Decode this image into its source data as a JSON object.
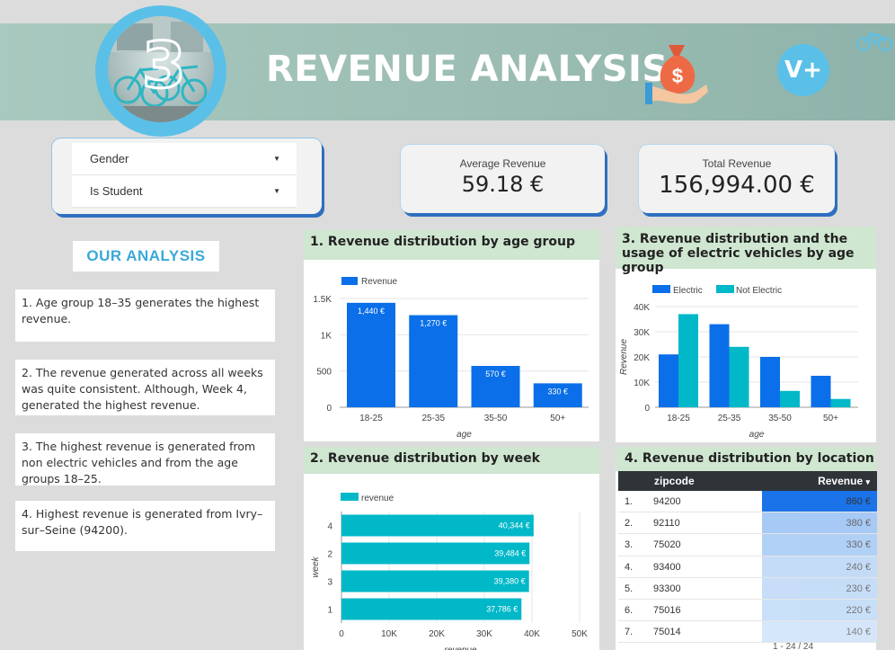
{
  "header": {
    "title": "REVENUE ANALYSIS",
    "logo_text": "3",
    "badge_text": "V+",
    "icons": [
      "bikes-logo",
      "moneybag-icon",
      "bike-icon"
    ]
  },
  "filters": {
    "gender_label": "Gender",
    "student_label": "Is Student"
  },
  "kpis": {
    "avg_label": "Average Revenue",
    "avg_value": "59.18 €",
    "total_label": "Total Revenue",
    "total_value": "156,994.00 €"
  },
  "analysis": {
    "title": "OUR ANALYSIS",
    "notes": [
      "1. Age group 18–35 generates the highest revenue.",
      "2.  The revenue generated across all weeks was quite consistent. Although, Week 4, generated the highest revenue.",
      "3.  The highest revenue is generated from non electric vehicles and from the age groups 18–25.",
      "4.  Highest revenue is generated from Ivry–sur–Seine (94200)."
    ]
  },
  "colors": {
    "bar_blue": "#0a6fe8",
    "bar_teal": "#00b8c8",
    "head_green": "#cfe6d1",
    "accent": "#5bc0e8"
  },
  "chart_data": [
    {
      "type": "bar",
      "title": "1. Revenue distribution by age group",
      "categories": [
        "18-25",
        "25-35",
        "35-50",
        "50+"
      ],
      "series": [
        {
          "name": "Revenue",
          "values": [
            1440,
            1270,
            570,
            330
          ]
        }
      ],
      "data_labels": [
        "1,440 €",
        "1,270 €",
        "570 €",
        "330 €"
      ],
      "xlabel": "age",
      "ylabel": "",
      "yticks": [
        "0",
        "500",
        "1K",
        "1.5K"
      ],
      "ylim": [
        0,
        1500
      ],
      "legend": "top-left"
    },
    {
      "type": "bar",
      "title": "3. Revenue distribution and the usage of electric vehicles by age group",
      "categories": [
        "18-25",
        "25-35",
        "35-50",
        "50+"
      ],
      "series": [
        {
          "name": "Electric",
          "values": [
            21000,
            33000,
            20000,
            12500
          ]
        },
        {
          "name": "Not Electric",
          "values": [
            37000,
            24000,
            6500,
            3300
          ]
        }
      ],
      "xlabel": "age",
      "ylabel": "Revenue",
      "yticks": [
        "0",
        "10K",
        "20K",
        "30K",
        "40K"
      ],
      "ylim": [
        0,
        40000
      ],
      "legend": "top-left"
    },
    {
      "type": "bar",
      "orientation": "horizontal",
      "title": "2. Revenue distribution by week",
      "categories": [
        "4",
        "2",
        "3",
        "1"
      ],
      "series": [
        {
          "name": "revenue",
          "values": [
            40344,
            39484,
            39380,
            37786
          ]
        }
      ],
      "data_labels": [
        "40,344 €",
        "39,484 €",
        "39,380 €",
        "37,786 €"
      ],
      "xlabel": "revenue",
      "ylabel": "week",
      "xticks": [
        "0",
        "10K",
        "20K",
        "30K",
        "40K",
        "50K"
      ],
      "xlim": [
        0,
        50000
      ],
      "legend": "top-left"
    },
    {
      "type": "table",
      "title": "4. Revenue distribution by location",
      "columns": [
        "zipcode",
        "Revenue"
      ],
      "sort_indicator": "▾",
      "rows": [
        {
          "idx": "1.",
          "zip": "94200",
          "revenue": "860 €",
          "value": 860
        },
        {
          "idx": "2.",
          "zip": "92110",
          "revenue": "380 €",
          "value": 380
        },
        {
          "idx": "3.",
          "zip": "75020",
          "revenue": "330 €",
          "value": 330
        },
        {
          "idx": "4.",
          "zip": "93400",
          "revenue": "240 €",
          "value": 240
        },
        {
          "idx": "5.",
          "zip": "93300",
          "revenue": "230 €",
          "value": 230
        },
        {
          "idx": "6.",
          "zip": "75016",
          "revenue": "220 €",
          "value": 220
        },
        {
          "idx": "7.",
          "zip": "75014",
          "revenue": "140 €",
          "value": 140
        }
      ],
      "pager": "1 - 24 / 24"
    }
  ]
}
